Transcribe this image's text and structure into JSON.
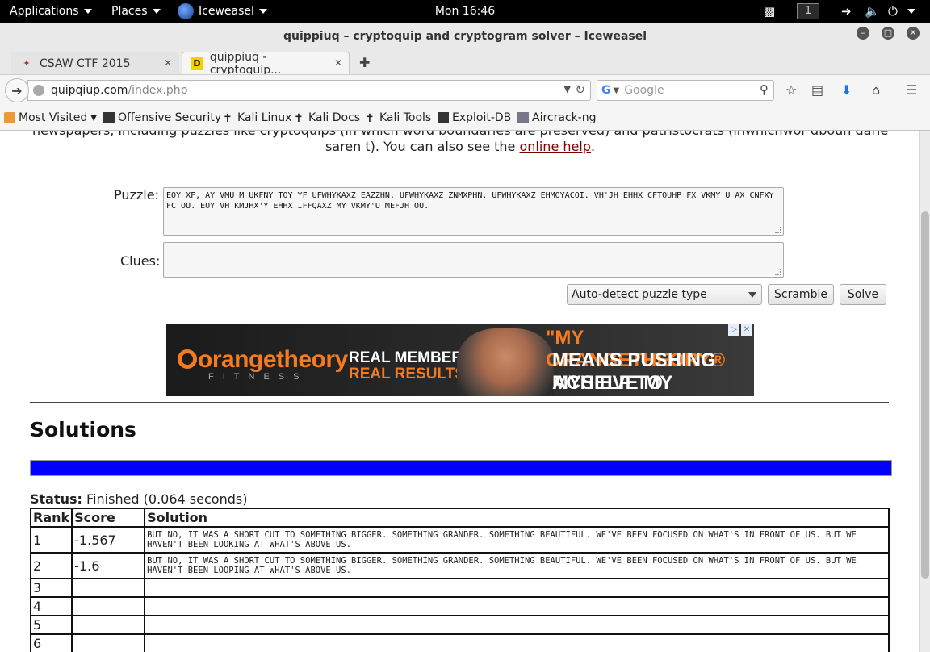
{
  "topbar": {
    "applications": "Applications",
    "places": "Places",
    "app": "Iceweasel",
    "clock": "Mon 16:46",
    "workspace": "1"
  },
  "window": {
    "title": "quippiuq – cryptoquip and cryptogram solver – Iceweasel"
  },
  "tabs": [
    {
      "label": "CSAW CTF 2015"
    },
    {
      "label": "quippiuq - cryptoquip..."
    }
  ],
  "nav": {
    "url_host": "quipqiup.com",
    "url_path": "/index.php",
    "search_placeholder": "Google"
  },
  "bookmarks": [
    {
      "label": "Most Visited"
    },
    {
      "label": "Offensive Security"
    },
    {
      "label": "Kali Linux"
    },
    {
      "label": "Kali Docs"
    },
    {
      "label": "Kali Tools"
    },
    {
      "label": "Exploit-DB"
    },
    {
      "label": "Aircrack-ng"
    }
  ],
  "page": {
    "intro_line1": "newspapers, including puzzles like cryptoquips (in which word boundaries are preserved) and patristocrats (inwhichwor dboun darie saren t). You can also see the",
    "intro_line2_pre": "saren t). You can also see the",
    "online_help": "online help",
    "intro_end": ".",
    "puzzle_label": "Puzzle:",
    "puzzle_text": "EOY XF, AY VMU M UKFNY TOY YF UFWHYKAXZ EAZZHN. UFWHYKAXZ ZNMXPHN. UFWHYKAXZ EHMOYACOI. VH'JH EHHX CFTOUHP FX VKMY'U AX CNFXY FC OU. EOY VH KMJHX'Y EHHX IFFQAXZ MY VKMY'U MEFJH OU.",
    "clues_label": "Clues:",
    "clues_text": "",
    "puzzle_type": "Auto-detect puzzle type",
    "scramble": "Scramble",
    "solve": "Solve",
    "ad": {
      "logo": "orangetheory",
      "fitness": "FITNESS",
      "real_members": "REAL MEMBERS.",
      "real_results": "REAL RESULTS.",
      "quote1": "\"MY ORANGETHEORY®",
      "quote2": "MEANS PUSHING MYSELF TO",
      "quote3": "ACHIEVE MY GOALS.\""
    },
    "solutions_title": "Solutions",
    "progress_fraction": 1.0,
    "progress_color": "#0000ff",
    "status_label": "Status:",
    "status_value": "Finished (0.064 seconds)",
    "table": {
      "headers": [
        "Rank",
        "Score",
        "Solution"
      ],
      "rows": [
        {
          "rank": "1",
          "score": "-1.567",
          "solution": "BUT NO, IT WAS A SHORT CUT TO SOMETHING BIGGER. SOMETHING GRANDER. SOMETHING BEAUTIFUL. WE'VE BEEN FOCUSED ON WHAT'S IN FRONT OF US. BUT WE HAVEN'T BEEN LOOKING AT WHAT'S ABOVE US."
        },
        {
          "rank": "2",
          "score": "-1.6",
          "solution": "BUT NO, IT WAS A SHORT CUT TO SOMETHING BIGGER. SOMETHING GRANDER. SOMETHING BEAUTIFUL. WE'VE BEEN FOCUSED ON WHAT'S IN FRONT OF US. BUT WE HAVEN'T BEEN LOOPING AT WHAT'S ABOVE US."
        },
        {
          "rank": "3",
          "score": "",
          "solution": ""
        },
        {
          "rank": "4",
          "score": "",
          "solution": ""
        },
        {
          "rank": "5",
          "score": "",
          "solution": ""
        },
        {
          "rank": "6",
          "score": "",
          "solution": ""
        }
      ]
    }
  }
}
